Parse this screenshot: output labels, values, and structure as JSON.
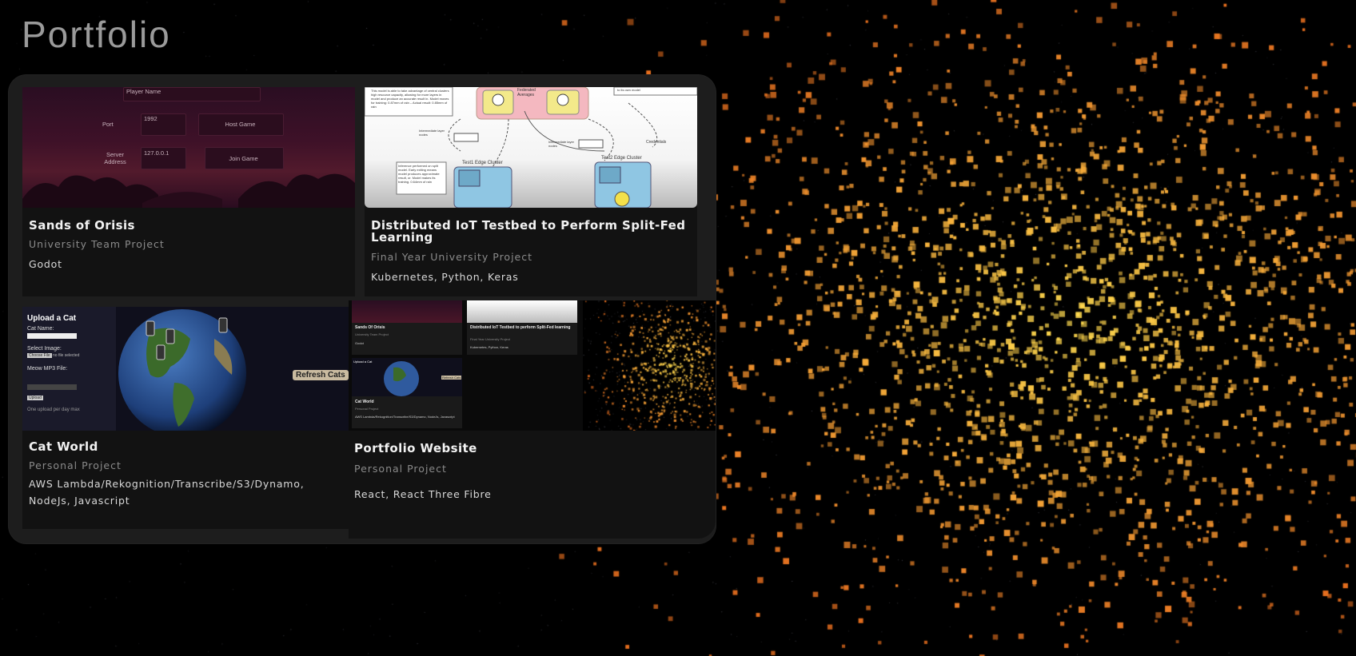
{
  "page": {
    "title": "Portfolio"
  },
  "projects": [
    {
      "title": "Sands of Orisis",
      "subtitle": "University Team Project",
      "tech": "Godot"
    },
    {
      "title": "Distributed IoT Testbed to Perform Split-Fed Learning",
      "subtitle": "Final Year University Project",
      "tech": "Kubernetes, Python, Keras"
    },
    {
      "title": "Cat World",
      "subtitle": "Personal Project",
      "tech": "AWS Lambda/Rekognition/Transcribe/S3/Dynamo, NodeJs, Javascript"
    },
    {
      "title": "Portfolio Website",
      "subtitle": "Personal Project",
      "tech": "React, React Three Fibre"
    }
  ],
  "thumb_game": {
    "player_name": "Player Name",
    "port_label": "Port",
    "port_value": "1992",
    "host_button": "Host Game",
    "server_label": "Server Address",
    "server_value": "127.0.0.1",
    "join_button": "Join Game"
  },
  "thumb_diagram": {
    "note_top": "This model is able to take advantage of central clusters high resource capacity, allowing for more layers in model and produce an accurate result in. Model moves for training: 0.87mm of rain – Actual result: 0.85mm of rain",
    "federated": "Federated Averages",
    "cluster1": "Test1 Edge Cluster",
    "cluster2": "Test2 Edge Cluster",
    "intermediate1": "Intermediate layer nodes",
    "intermediate2": "Intermediate layer nodes",
    "credentials": "Credentials",
    "note_bottom": "Inference performed on split model. Early exiting means model produces approximate result, or. Model makes its training. 0.64mm of rain",
    "own_model": "to its own model"
  },
  "thumb_cat": {
    "heading": "Upload a Cat",
    "cat_name_label": "Cat Name:",
    "select_image_label": "Select Image:",
    "choose_file": "Choose File",
    "no_file": "no file selected",
    "meow_label": "Meow MP3 File:",
    "upload_button": "Upload",
    "limit_note": "One upload per day max",
    "refresh_button": "Refresh Cats"
  },
  "thumb_portfolio": {
    "mini_title_1": "Sands Of Orisis",
    "mini_sub_1": "University Team Project",
    "mini_tech_1": "Godot",
    "mini_title_2": "Distributed IoT Testbed to perform Split-Fed learning",
    "mini_sub_2": "Final Year University Project",
    "mini_tech_2": "Kubernetes, Python, Keras",
    "mini_title_3": "Cat World",
    "mini_sub_3": "Personal Project",
    "mini_tech_3": "AWS Lambda/Rekognition/Transcribe/S3/Dynamo, NodeJs, Javascript",
    "mini_refresh": "Refresh Cats",
    "mini_upload": "Upload a Cat"
  },
  "colors": {
    "accent": "#f28c28",
    "panel": "#1d1d1d",
    "card": "#121212"
  }
}
